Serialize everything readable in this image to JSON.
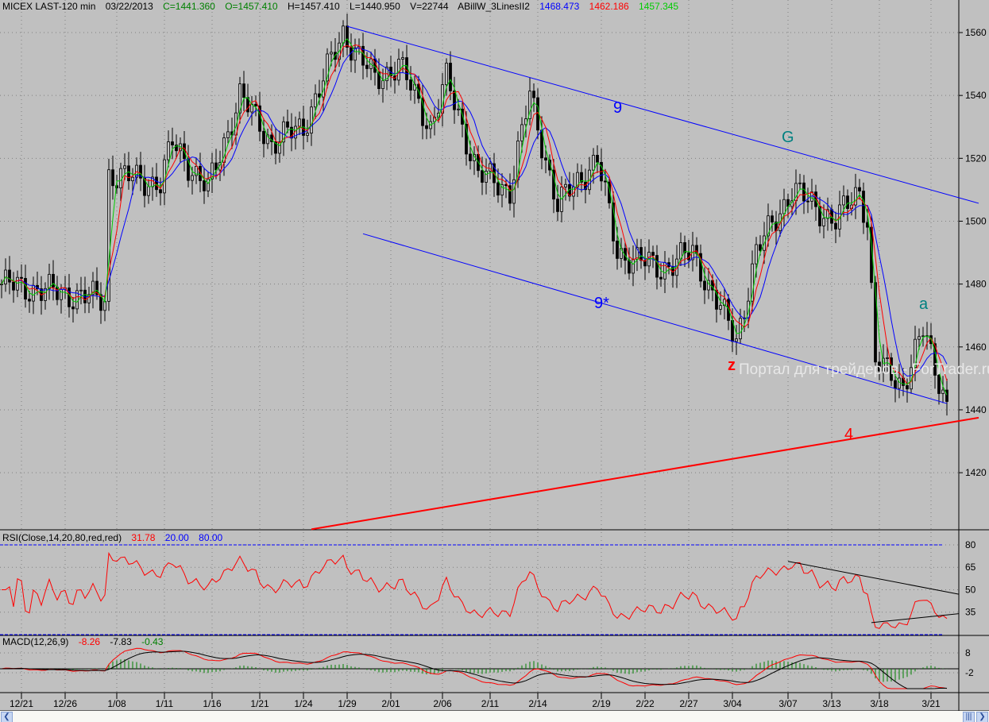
{
  "header": {
    "symbol": "MICEX LAST-120 min",
    "date": "03/22/2013",
    "close": "C=1441.360",
    "open": "O=1457.410",
    "high": "H=1457.410",
    "low": "L=1440.950",
    "volume": "V=22744",
    "indicator": "ABillW_3LinesII2",
    "ind_blue": "1468.473",
    "ind_red": "1462.186",
    "ind_green": "1457.345"
  },
  "rsi_header": {
    "label": "RSI(Close,14,20,80,red,red)",
    "value": "31.78",
    "low": "20.00",
    "high": "80.00"
  },
  "macd_header": {
    "label": "MACD(12,26,9)",
    "macd": "-8.26",
    "signal": "-7.83",
    "hist": "-0.43"
  },
  "watermark": "Портал для трейдеров - ForTrader.ru",
  "annotations": {
    "wave_9": "9",
    "wave_G": "G",
    "wave_9star": "9*",
    "wave_a": "a",
    "wave_z": "z",
    "wave_4": "4"
  },
  "colors": {
    "bg": "#c0c0c0",
    "green": "#00cc00",
    "red": "#ff0000",
    "blue": "#0000ff",
    "teal": "#008080"
  },
  "chart_data": {
    "type": "candlestick",
    "title": "MICEX LAST-120 min",
    "price_axis": {
      "ticks": [
        1420,
        1440,
        1460,
        1480,
        1500,
        1520,
        1540,
        1560
      ],
      "range": [
        1400,
        1566
      ]
    },
    "rsi_axis": {
      "ticks": [
        80,
        65,
        50,
        35
      ],
      "levels": [
        20,
        80
      ]
    },
    "macd_axis": {
      "ticks": [
        8,
        -2
      ]
    },
    "x_ticks": [
      {
        "label": "12/21",
        "bar": 5
      },
      {
        "label": "12/26",
        "bar": 16
      },
      {
        "label": "1/08",
        "bar": 29
      },
      {
        "label": "1/11",
        "bar": 41
      },
      {
        "label": "1/16",
        "bar": 53
      },
      {
        "label": "1/21",
        "bar": 65
      },
      {
        "label": "1/24",
        "bar": 76
      },
      {
        "label": "1/29",
        "bar": 87
      },
      {
        "label": "2/01",
        "bar": 98
      },
      {
        "label": "2/06",
        "bar": 111
      },
      {
        "label": "2/11",
        "bar": 123
      },
      {
        "label": "2/14",
        "bar": 135
      },
      {
        "label": "2/19",
        "bar": 151
      },
      {
        "label": "2/22",
        "bar": 162
      },
      {
        "label": "2/27",
        "bar": 173
      },
      {
        "label": "3/04",
        "bar": 184
      },
      {
        "label": "3/07",
        "bar": 198
      },
      {
        "label": "3/13",
        "bar": 209
      },
      {
        "label": "3/18",
        "bar": 221
      },
      {
        "label": "3/21",
        "bar": 234
      }
    ],
    "close_keypoints": [
      [
        0,
        1480
      ],
      [
        26,
        1475
      ],
      [
        27,
        1515
      ],
      [
        40,
        1512
      ],
      [
        43,
        1525
      ],
      [
        52,
        1510
      ],
      [
        60,
        1540
      ],
      [
        68,
        1525
      ],
      [
        76,
        1530
      ],
      [
        86,
        1560
      ],
      [
        94,
        1545
      ],
      [
        100,
        1550
      ],
      [
        108,
        1530
      ],
      [
        112,
        1545
      ],
      [
        120,
        1515
      ],
      [
        128,
        1510
      ],
      [
        133,
        1540
      ],
      [
        140,
        1505
      ],
      [
        150,
        1520
      ],
      [
        155,
        1490
      ],
      [
        166,
        1485
      ],
      [
        174,
        1490
      ],
      [
        185,
        1462
      ],
      [
        190,
        1490
      ],
      [
        199,
        1510
      ],
      [
        210,
        1500
      ],
      [
        216,
        1510
      ],
      [
        218,
        1500
      ],
      [
        220,
        1455
      ],
      [
        227,
        1448
      ],
      [
        232,
        1465
      ],
      [
        238,
        1442
      ]
    ],
    "trendlines": [
      {
        "name": "upper-channel",
        "color": "blue",
        "from": [
          87,
          1562
        ],
        "to": [
          246,
          1505.7
        ]
      },
      {
        "name": "lower-channel",
        "color": "blue",
        "from": [
          91,
          1496
        ],
        "to": [
          238,
          1442
        ]
      },
      {
        "name": "support-4",
        "color": "red",
        "from": [
          78,
          1402
        ],
        "to": [
          246,
          1437.5
        ]
      }
    ],
    "rsi_trendlines": [
      {
        "from": [
          198,
          69
        ],
        "to": [
          241,
          47
        ]
      },
      {
        "from": [
          219,
          28
        ],
        "to": [
          241,
          34
        ]
      }
    ]
  }
}
